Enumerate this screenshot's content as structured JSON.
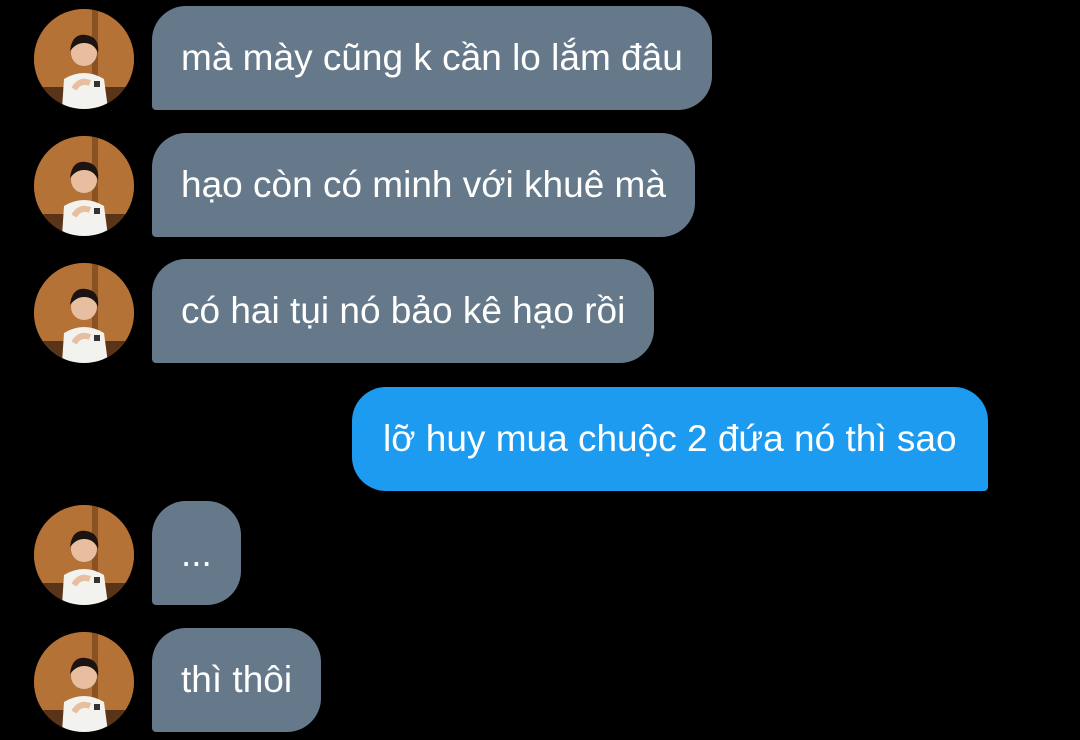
{
  "conversation": {
    "messages": [
      {
        "direction": "incoming",
        "text": "mà mày cũng k cần lo lắm đâu"
      },
      {
        "direction": "incoming",
        "text": "hạo còn có minh với khuê mà"
      },
      {
        "direction": "incoming",
        "text": "có hai tụi nó bảo kê hạo rồi"
      },
      {
        "direction": "outgoing",
        "text": "lỡ huy mua chuộc 2 đứa nó thì sao"
      },
      {
        "direction": "incoming",
        "text": "..."
      },
      {
        "direction": "incoming",
        "text": "thì thôi"
      }
    ]
  },
  "colors": {
    "background": "#000000",
    "incoming_bubble": "#65798a",
    "outgoing_bubble": "#1d9bf0",
    "text": "#ffffff"
  },
  "icons": {
    "avatar": "contact-avatar-photo"
  }
}
